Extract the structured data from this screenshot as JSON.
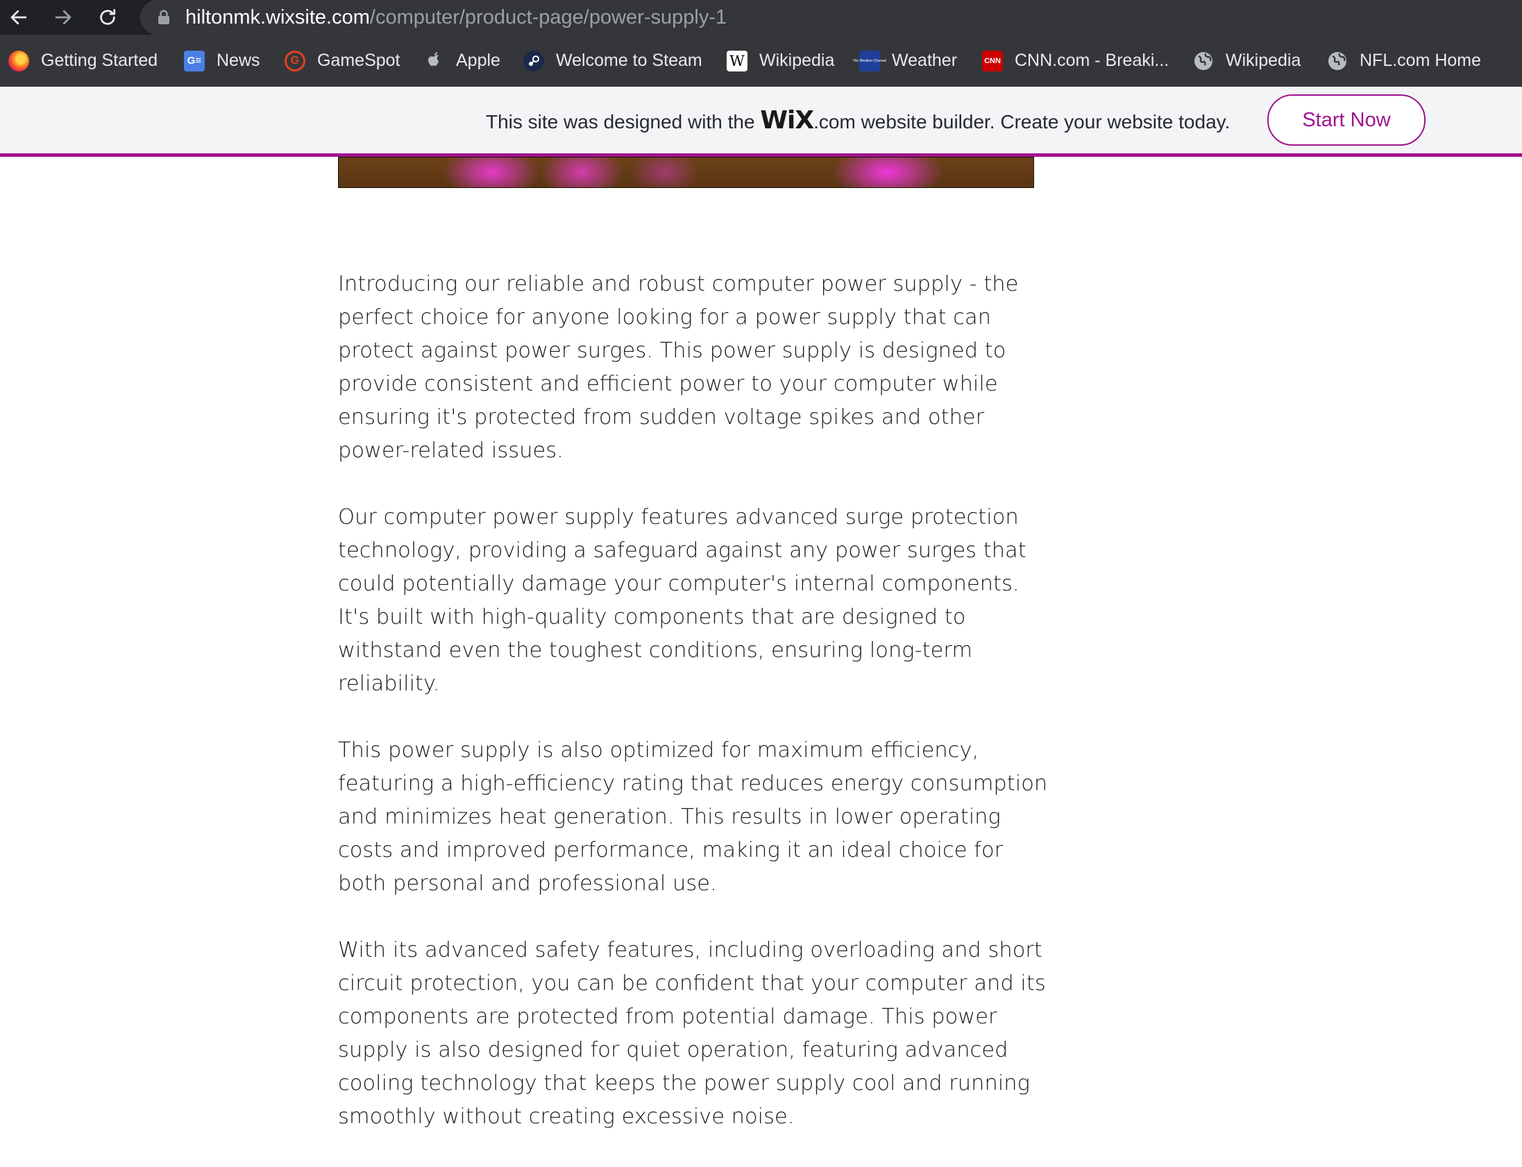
{
  "browser": {
    "url_host": "hiltonmk.wixsite.com",
    "url_path": "/computer/product-page/power-supply-1",
    "bookmarks": [
      {
        "label": "Getting Started",
        "icon": "firefox-icon"
      },
      {
        "label": "News",
        "icon": "google-news-icon"
      },
      {
        "label": "GameSpot",
        "icon": "gamespot-icon"
      },
      {
        "label": "Apple",
        "icon": "apple-icon"
      },
      {
        "label": "Welcome to Steam",
        "icon": "steam-icon"
      },
      {
        "label": "Wikipedia",
        "icon": "wikipedia-icon"
      },
      {
        "label": "Weather",
        "icon": "weather-channel-icon"
      },
      {
        "label": "CNN.com - Breaki...",
        "icon": "cnn-icon"
      },
      {
        "label": "Wikipedia",
        "icon": "globe-icon"
      },
      {
        "label": "NFL.com Home",
        "icon": "globe-icon"
      }
    ],
    "favicon_text": {
      "news": "G≡",
      "gamespot": "G",
      "wikipedia": "W",
      "weather": "The Weather Channel",
      "cnn": "CNN"
    }
  },
  "wix_banner": {
    "text_before": "This site was designed with the ",
    "logo_text": "WiX",
    "text_after": ".com website builder. Create your website today.",
    "button_label": "Start Now",
    "accent_color": "#a0138e"
  },
  "product": {
    "paragraphs": [
      "Introducing our reliable and robust computer power supply - the perfect choice for anyone looking for a power supply that can protect against power surges. This power supply is designed to provide consistent and efficient power to your computer while ensuring it's protected from sudden voltage spikes and other power-related issues.",
      "Our computer power supply features advanced surge protection technology, providing a safeguard against any power surges that could potentially damage your computer's internal components. It's built with high-quality components that are designed to withstand even the toughest conditions, ensuring long-term reliability.",
      "This power supply is also optimized for maximum efficiency, featuring a high-efficiency rating that reduces energy consumption and minimizes heat generation. This results in lower operating costs and improved performance, making it an ideal choice for both personal and professional use.",
      "With its advanced safety features, including overloading and short circuit protection, you can be confident that your computer and its components are protected from potential damage. This power supply is also designed for quiet operation, featuring advanced cooling technology that keeps the power supply cool and running smoothly without creating excessive noise."
    ]
  }
}
